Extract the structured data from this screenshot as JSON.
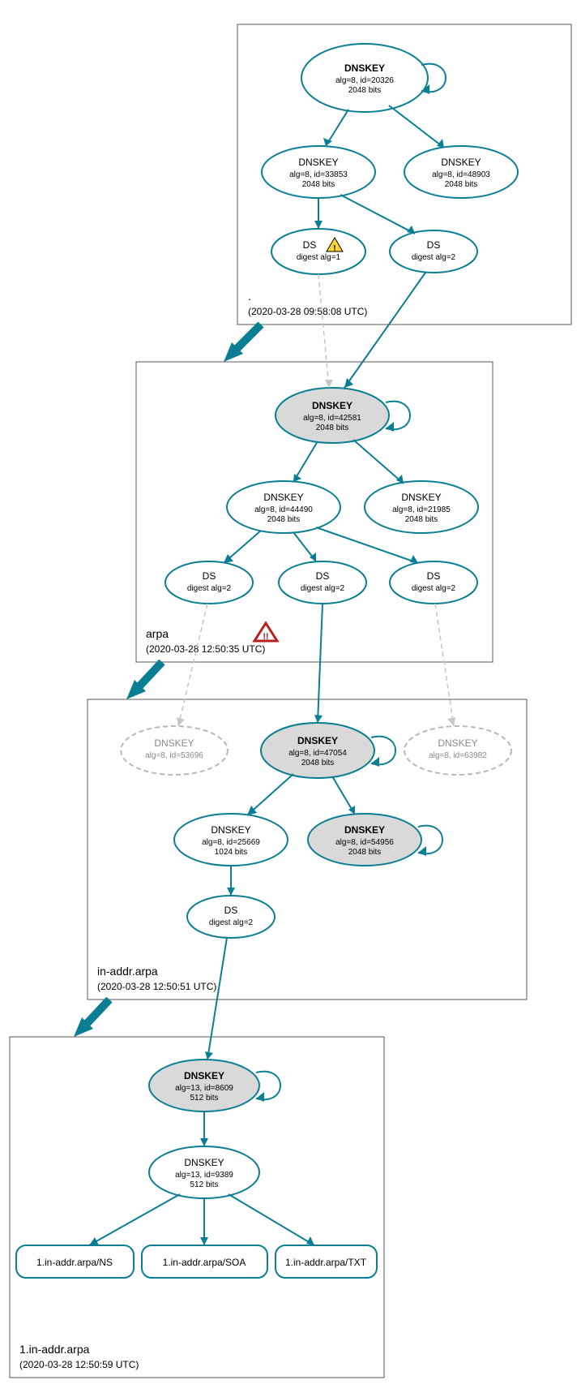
{
  "colors": {
    "teal": "#0a7f94",
    "grey_fill": "#d9d9d9",
    "ghost": "#c5c5c5"
  },
  "zones": {
    "root": {
      "name": ".",
      "timestamp": "(2020-03-28 09:58:08 UTC)"
    },
    "arpa": {
      "name": "arpa",
      "timestamp": "(2020-03-28 12:50:35 UTC)"
    },
    "inaddr": {
      "name": "in-addr.arpa",
      "timestamp": "(2020-03-28 12:50:51 UTC)"
    },
    "one": {
      "name": "1.in-addr.arpa",
      "timestamp": "(2020-03-28 12:50:59 UTC)"
    }
  },
  "nodes": {
    "root_ksk": {
      "title": "DNSKEY",
      "l2": "alg=8, id=20326",
      "l3": "2048 bits"
    },
    "root_zsk1": {
      "title": "DNSKEY",
      "l2": "alg=8, id=33853",
      "l3": "2048 bits"
    },
    "root_zsk2": {
      "title": "DNSKEY",
      "l2": "alg=8, id=48903",
      "l3": "2048 bits"
    },
    "root_ds1": {
      "title": "DS",
      "l2": "digest alg=1"
    },
    "root_ds2": {
      "title": "DS",
      "l2": "digest alg=2"
    },
    "arpa_ksk": {
      "title": "DNSKEY",
      "l2": "alg=8, id=42581",
      "l3": "2048 bits"
    },
    "arpa_zsk1": {
      "title": "DNSKEY",
      "l2": "alg=8, id=44490",
      "l3": "2048 bits"
    },
    "arpa_zsk2": {
      "title": "DNSKEY",
      "l2": "alg=8, id=21985",
      "l3": "2048 bits"
    },
    "arpa_ds1": {
      "title": "DS",
      "l2": "digest alg=2"
    },
    "arpa_ds2": {
      "title": "DS",
      "l2": "digest alg=2"
    },
    "arpa_ds3": {
      "title": "DS",
      "l2": "digest alg=2"
    },
    "in_ghost1": {
      "title": "DNSKEY",
      "l2": "alg=8, id=53696"
    },
    "in_ksk": {
      "title": "DNSKEY",
      "l2": "alg=8, id=47054",
      "l3": "2048 bits"
    },
    "in_ghost2": {
      "title": "DNSKEY",
      "l2": "alg=8, id=63982"
    },
    "in_zsk": {
      "title": "DNSKEY",
      "l2": "alg=8, id=25669",
      "l3": "1024 bits"
    },
    "in_key2": {
      "title": "DNSKEY",
      "l2": "alg=8, id=54956",
      "l3": "2048 bits"
    },
    "in_ds": {
      "title": "DS",
      "l2": "digest alg=2"
    },
    "one_ksk": {
      "title": "DNSKEY",
      "l2": "alg=13, id=8609",
      "l3": "512 bits"
    },
    "one_zsk": {
      "title": "DNSKEY",
      "l2": "alg=13, id=9389",
      "l3": "512 bits"
    },
    "one_ns": {
      "title": "1.in-addr.arpa/NS"
    },
    "one_soa": {
      "title": "1.in-addr.arpa/SOA"
    },
    "one_txt": {
      "title": "1.in-addr.arpa/TXT"
    }
  },
  "icons": {
    "warning": "!",
    "error": "!!"
  }
}
